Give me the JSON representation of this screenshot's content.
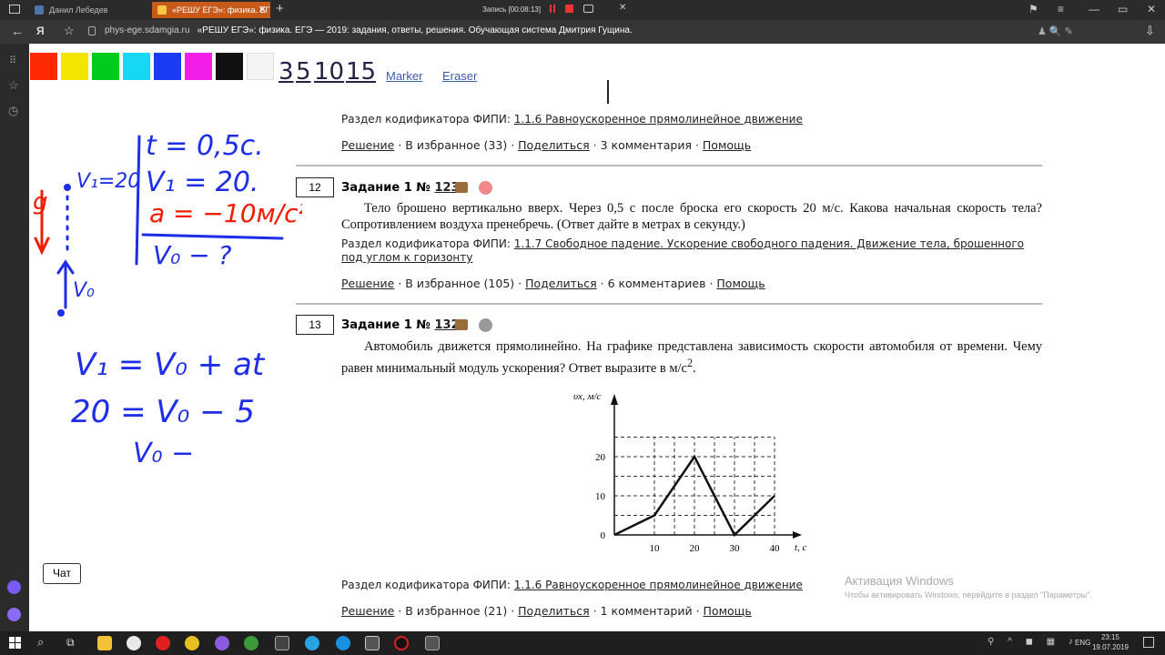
{
  "browser": {
    "tabs": [
      {
        "label": "Данил Лебедев"
      },
      {
        "label": "«РЕШУ ЕГЭ»: физика. ЕГ"
      }
    ],
    "recording": "Запись [00:08:13]",
    "address": {
      "domain": "phys-ege.sdamgia.ru",
      "title": "«РЕШУ ЕГЭ»: физика. ЕГЭ — 2019: задания, ответы, решения. Обучающая система Дмитрия Гущина."
    }
  },
  "palette": {
    "colors": [
      "#ff2a00",
      "#f2e600",
      "#00cc1e",
      "#17d8f2",
      "#1a3cf2",
      "#f21ee8",
      "#111111",
      "#f4f4f4"
    ],
    "sizes": [
      "3",
      "5",
      "10",
      "15"
    ],
    "marker": "Marker",
    "eraser": "Eraser"
  },
  "problems": {
    "prev": {
      "codif_label": "Раздел кодификатора ФИПИ:",
      "codif_link": "1.1.6 Равноускоренное прямолинейное движение",
      "solution": "Решение",
      "fav": "В избранное (33)",
      "share": "Поделиться",
      "comments": "3 комментария",
      "help": "Помощь"
    },
    "p12": {
      "num": "12",
      "title": "Задание 1 №",
      "id": "123",
      "text": "Тело брошено вертикально вверх. Через 0,5 с после броска его скорость 20 м/с. Какова начальная скорость тела? Сопротивлением воздуха пренебречь. (Ответ дайте в метрах в секунду.)",
      "codif_label": "Раздел кодификатора ФИПИ:",
      "codif_link": "1.1.7 Свободное падение. Ускорение свободного падения. Движение тела, брошенного под углом к горизонту",
      "solution": "Решение",
      "fav": "В избранное (105)",
      "share": "Поделиться",
      "comments": "6 комментариев",
      "help": "Помощь"
    },
    "p13": {
      "num": "13",
      "title": "Задание 1 №",
      "id": "132",
      "text": "Автомобиль движется прямолинейно. На графике представлена зависимость скорости автомобиля от времени. Чему равен минимальный модуль ускорения? Ответ выразите в м/с",
      "text_sup": "2",
      "text_end": ".",
      "codif_label": "Раздел кодификатора ФИПИ:",
      "codif_link": "1.1.6 Равноускоренное прямолинейное движение",
      "solution": "Решение",
      "fav": "В избранное (21)",
      "share": "Поделиться",
      "comments": "1 комментарий",
      "help": "Помощь"
    }
  },
  "chart_data": {
    "type": "line",
    "x": [
      0,
      10,
      20,
      30,
      40
    ],
    "y": [
      0,
      5,
      20,
      0,
      10
    ],
    "xticks": [
      "10",
      "20",
      "30",
      "40"
    ],
    "yticks": [
      "0",
      "10",
      "20"
    ],
    "xlabel": "t, с",
    "ylabel": "υx, м/с",
    "xlim": [
      0,
      40
    ],
    "ylim": [
      0,
      25
    ],
    "grid": true
  },
  "handwriting": {
    "eq1": "t = 0,5c.",
    "eq2": "V₁ = 20.",
    "eq3": "a = −10м/с²",
    "eq4": "V₀ − ?",
    "label_v1": "V₁=20",
    "label_g": "g",
    "label_v0": "V₀",
    "formula1": "V₁ = V₀ + at",
    "formula2": "20 = V₀ − 5",
    "formula3": "V₀ −"
  },
  "chat": "Чат",
  "activation": {
    "title": "Активация Windows",
    "subtitle": "Чтобы активировать Windows, перейдите в раздел \"Параметры\"."
  },
  "taskbar": {
    "lang": "ENG",
    "time": "23:15",
    "date": "19.07.2019"
  }
}
